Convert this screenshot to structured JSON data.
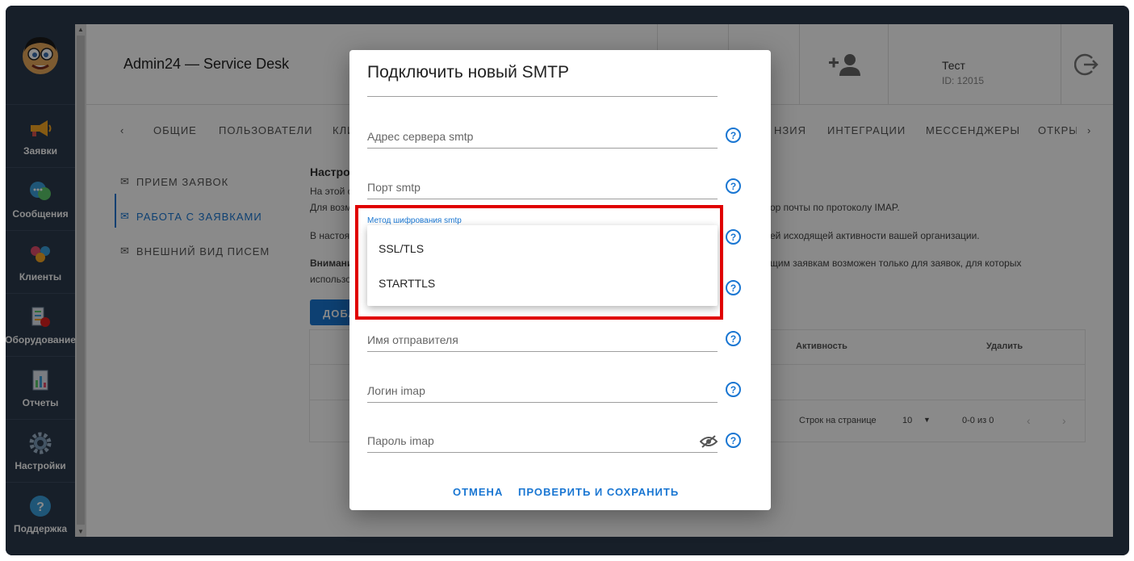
{
  "app": {
    "title": "Admin24 — Service Desk"
  },
  "user": {
    "name": "Тест",
    "id": "ID: 12015"
  },
  "sidebar": {
    "items": [
      {
        "label": "Заявки",
        "icon": "megaphone-icon"
      },
      {
        "label": "Сообщения",
        "icon": "chat-icon"
      },
      {
        "label": "Клиенты",
        "icon": "clients-icon"
      },
      {
        "label": "Оборудование",
        "icon": "equipment-icon"
      },
      {
        "label": "Отчеты",
        "icon": "report-icon"
      },
      {
        "label": "Настройки",
        "icon": "gear-icon"
      },
      {
        "label": "Поддержка",
        "icon": "help-icon"
      }
    ]
  },
  "tabs": [
    "ОБЩИЕ",
    "ПОЛЬЗОВАТЕЛИ",
    "КЛИ",
    "НЗИЯ",
    "ИНТЕГРАЦИИ",
    "МЕССЕНДЖЕРЫ",
    "ОТКРЫ"
  ],
  "submenu": [
    "ПРИЕМ ЗАЯВОК",
    "РАБОТА С ЗАЯВКАМИ",
    "ВНЕШНИЙ ВИД ПИСЕМ"
  ],
  "background": {
    "heading": "Настрой",
    "line1": "На этой с",
    "line2": "Для возм",
    "line2b": "ор почты по протоколу IMAP.",
    "line3": "В настоя",
    "line3b": "ей исходящей активности вашей организации.",
    "line4": "Внимани",
    "line4b": "щим заявкам возможен только для заявок, для которых",
    "line5": "использо",
    "add_button": "ДОБА",
    "col_activity": "Активность",
    "col_delete": "Удалить",
    "rows_per_page_label": "Строк на странице",
    "rows_per_page": "10",
    "range": "0-0 из 0"
  },
  "dialog": {
    "title": "Подключить новый SMTP",
    "fields": {
      "server": "Адрес сервера smtp",
      "port": "Порт smtp",
      "encryption_label": "Метод шифрования smtp",
      "sender": "Имя отправителя",
      "login": "Логин imap",
      "password": "Пароль imap"
    },
    "options": [
      "SSL/TLS",
      "STARTTLS"
    ],
    "cancel": "ОТМЕНА",
    "save": "ПРОВЕРИТЬ И СОХРАНИТЬ",
    "help_glyph": "?"
  },
  "colors": {
    "accent": "#1976d2",
    "sidebar": "#2b3a4d",
    "highlight": "#e00000"
  }
}
